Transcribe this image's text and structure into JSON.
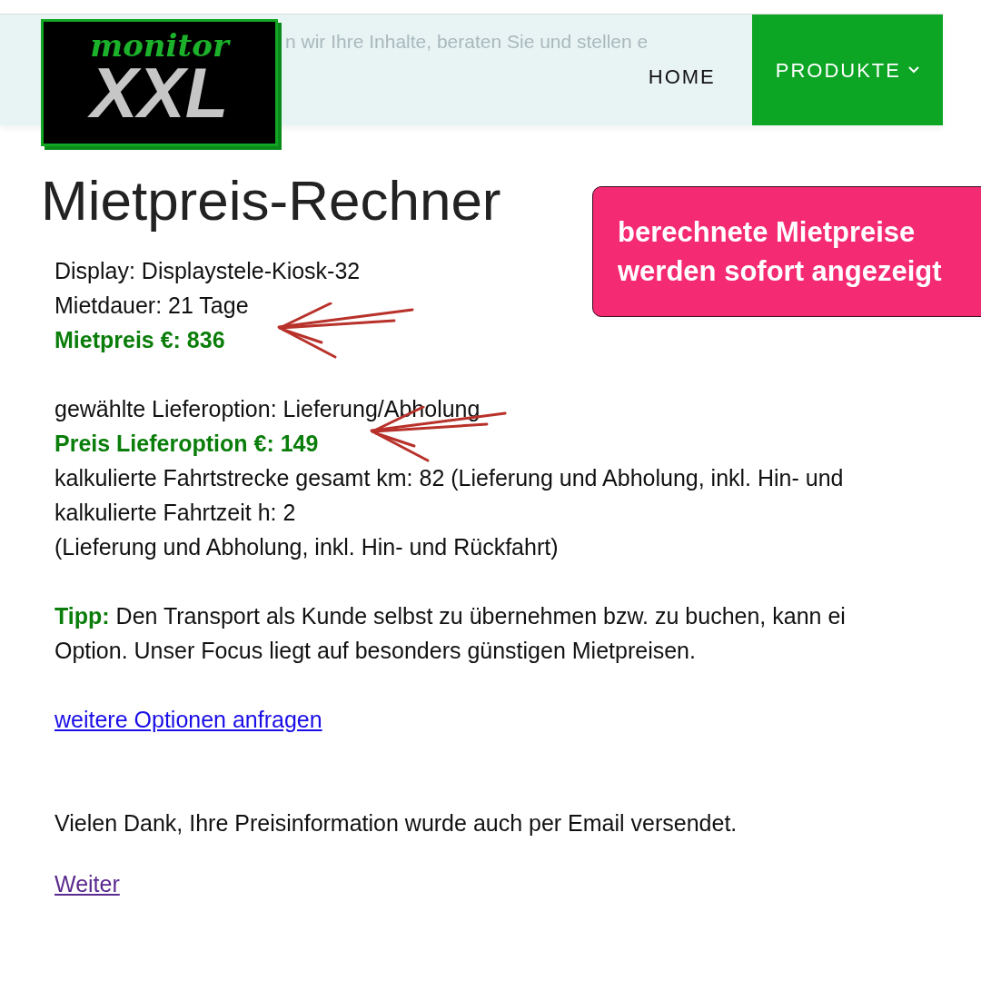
{
  "header": {
    "logo": {
      "top": "monitor",
      "bottom": "XXL"
    },
    "marquee": "n wir Ihre Inhalte, beraten Sie und stellen e",
    "nav": [
      {
        "label": "HOME",
        "selected": false,
        "dropdown": false
      },
      {
        "label": "PRODUKTE",
        "selected": true,
        "dropdown": true
      }
    ]
  },
  "title": "Mietpreis-Rechner",
  "callout": {
    "lines": [
      "berechnete Mietpreise",
      "werden sofort angezeigt"
    ]
  },
  "result": [
    {
      "kind": "text",
      "text": "Display: Displaystele-Kiosk-32"
    },
    {
      "kind": "text",
      "text": "Mietdauer: 21 Tage"
    },
    {
      "kind": "price",
      "text": "Mietpreis €: 836",
      "arrow": true
    },
    {
      "kind": "gap"
    },
    {
      "kind": "text",
      "text": "gewählte Lieferoption: Lieferung/Abholung"
    },
    {
      "kind": "price",
      "text": "Preis Lieferoption €: 149",
      "arrow": true
    },
    {
      "kind": "text",
      "text": "kalkulierte Fahrtstrecke gesamt km: 82 (Lieferung und Abholung, inkl. Hin- und"
    },
    {
      "kind": "text",
      "text": "kalkulierte Fahrtzeit h: 2"
    },
    {
      "kind": "text",
      "text": "(Lieferung und Abholung, inkl. Hin- und Rückfahrt)"
    },
    {
      "kind": "gap"
    },
    {
      "kind": "tip",
      "text": "**Tipp:** Den Transport als Kunde selbst zu übernehmen bzw. zu buchen, kann ei"
    },
    {
      "kind": "text",
      "text": "Option. Unser Focus liegt auf besonders günstigen Mietpreisen."
    },
    {
      "kind": "gap"
    },
    {
      "kind": "link",
      "text": "weitere Optionen anfragen",
      "visited": false
    },
    {
      "kind": "gap"
    },
    {
      "kind": "gap"
    },
    {
      "kind": "text",
      "text": "Vielen Dank, Ihre Preisinformation wurde auch per Email versendet."
    },
    {
      "kind": "spacer"
    },
    {
      "kind": "link",
      "text": "Weiter",
      "visited": true
    }
  ]
}
